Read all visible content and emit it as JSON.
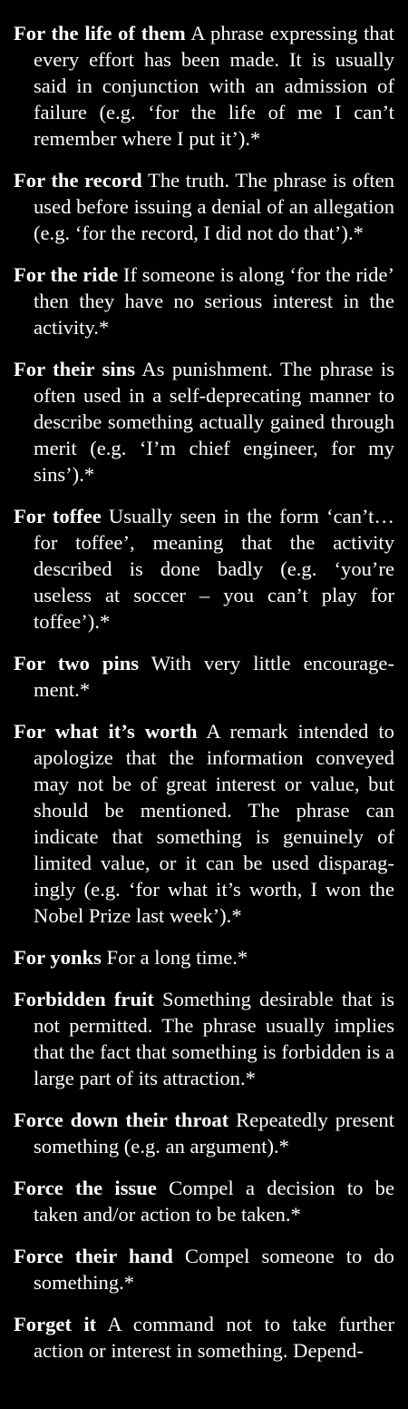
{
  "entries": [
    {
      "term": "For the life of them",
      "definition": "A phrase expressing that every effort has been made. It is usually said in conjunction with an admission of failure (e.g. ‘for the life of me I can’t remember where I put it’).*"
    },
    {
      "term": "For the record",
      "definition": "The truth. The phrase is often used before issuing a denial of an allegation (e.g. ‘for the record, I did not do that’).*"
    },
    {
      "term": "For the ride",
      "definition": "If someone is along ‘for the ride’ then they have no serious interest in the activity.*"
    },
    {
      "term": "For their sins",
      "definition": "As punishment. The phrase is often used in a self-deprecating manner to describe something actually gained through merit (e.g. ‘I’m chief engineer, for my sins’).*"
    },
    {
      "term": "For toffee",
      "definition": "Usually seen in the form ‘can’t…for toffee’, meaning that the activity described is done badly (e.g. ‘you’re useless at soccer – you can’t play for toffee’).*"
    },
    {
      "term": "For two pins",
      "definition": "With very little encourage-ment.*"
    },
    {
      "term": "For what it’s worth",
      "definition": "A remark intended to apologize that the information conveyed may not be of great interest or value, but should be mentioned. The phrase can indicate that something is genuinely of limited value, or it can be used disparag-ingly (e.g. ‘for what it’s worth, I won the Nobel Prize last week’).*"
    },
    {
      "term": "For yonks",
      "definition": "For a long time.*"
    },
    {
      "term": "Forbidden fruit",
      "definition": "Something desirable that is not permitted. The phrase usually implies that the fact that something is forbidden is a large part of its attraction.*"
    },
    {
      "term": "Force down their throat",
      "definition": "Repeatedly present something (e.g. an argument).*"
    },
    {
      "term": "Force the issue",
      "definition": "Compel a decision to be taken and/or action to be taken.*"
    },
    {
      "term": "Force their hand",
      "definition": "Compel someone to do something.*"
    },
    {
      "term": "Forget it",
      "definition": "A command not to take further action or interest in something. Depend-"
    }
  ]
}
